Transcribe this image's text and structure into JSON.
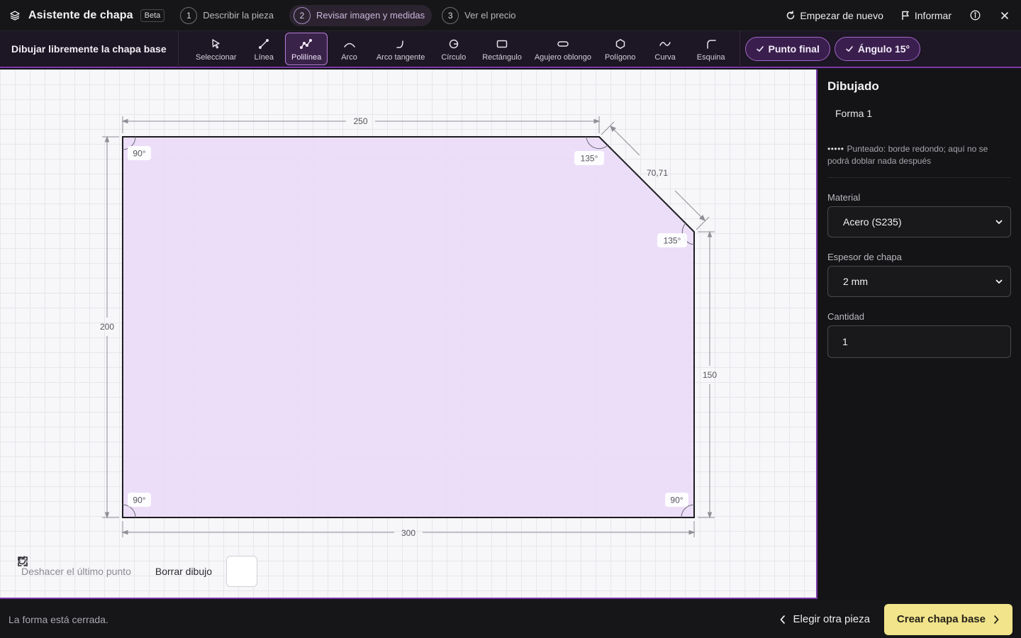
{
  "header": {
    "app_title": "Asistente de chapa",
    "badge": "Beta",
    "steps": [
      {
        "num": "1",
        "label": "Describir la pieza"
      },
      {
        "num": "2",
        "label": "Revisar imagen y medidas"
      },
      {
        "num": "3",
        "label": "Ver el precio"
      }
    ],
    "restart_label": "Empezar de nuevo",
    "report_label": "Informar"
  },
  "toolbar": {
    "title": "Dibujar libremente la chapa base",
    "tools": [
      {
        "label": "Seleccionar",
        "icon": "cursor-icon"
      },
      {
        "label": "Línea",
        "icon": "line-icon"
      },
      {
        "label": "Polilínea",
        "icon": "polyline-icon",
        "active": true
      },
      {
        "label": "Arco",
        "icon": "arc-icon"
      },
      {
        "label": "Arco tangente",
        "icon": "tangent-arc-icon"
      },
      {
        "label": "Círculo",
        "icon": "circle-icon"
      },
      {
        "label": "Rectángulo",
        "icon": "rectangle-icon"
      },
      {
        "label": "Agujero oblongo",
        "icon": "slot-icon"
      },
      {
        "label": "Polígono",
        "icon": "polygon-icon"
      },
      {
        "label": "Curva",
        "icon": "curve-icon"
      },
      {
        "label": "Esquina",
        "icon": "corner-icon"
      }
    ],
    "snap_endpoint": "Punto final",
    "snap_angle": "Ángulo 15°"
  },
  "drawing": {
    "dimensions": {
      "top": "250",
      "diagonal": "70,71",
      "left": "200",
      "right": "150",
      "bottom": "300"
    },
    "angles": {
      "top_left": "90°",
      "top_right_1": "135°",
      "top_right_2": "135°",
      "bottom_left": "90°",
      "bottom_right": "90°"
    },
    "fill_color": "#ead9f9",
    "undo_label": "Deshacer el último punto",
    "clear_label": "Borrar dibujo"
  },
  "panel": {
    "title": "Dibujado",
    "shape_item": "Forma 1",
    "note": "Punteado: borde redondo; aquí no se podrá doblar nada después",
    "material_label": "Material",
    "material_value": "Acero (S235)",
    "thickness_label": "Espesor de chapa",
    "thickness_value": "2 mm",
    "quantity_label": "Cantidad",
    "quantity_value": "1"
  },
  "footer": {
    "status": "La forma está cerrada.",
    "back_label": "Elegir otra pieza",
    "primary_label": "Crear chapa base"
  },
  "colors": {
    "accent": "#7a3aa8",
    "primary_button": "#f1e48a"
  }
}
